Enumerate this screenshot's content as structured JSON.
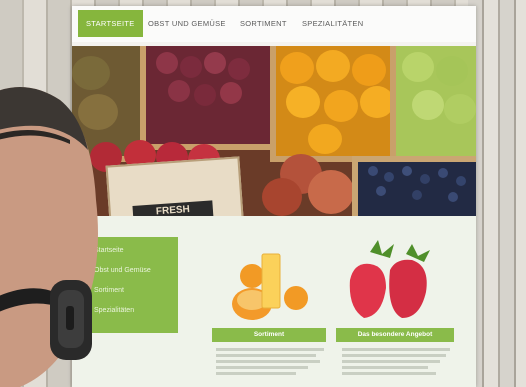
{
  "nav": {
    "items": [
      {
        "label": "STARTSEITE",
        "active": true
      },
      {
        "label": "OBST UND GEMÜSE",
        "active": false
      },
      {
        "label": "SORTIMENT",
        "active": false
      },
      {
        "label": "SPEZIALITÄTEN",
        "active": false
      }
    ]
  },
  "hero": {
    "bag_label": "FRESH"
  },
  "sidemenu": {
    "items": [
      "Startseite",
      "Obst und Gemüse",
      "Sortiment",
      "Spezialitäten"
    ]
  },
  "features": [
    {
      "caption": "Sortiment"
    },
    {
      "caption": "Das besondere Angebot"
    }
  ],
  "colors": {
    "accent": "#86b63d",
    "page": "#f4f3f0"
  }
}
